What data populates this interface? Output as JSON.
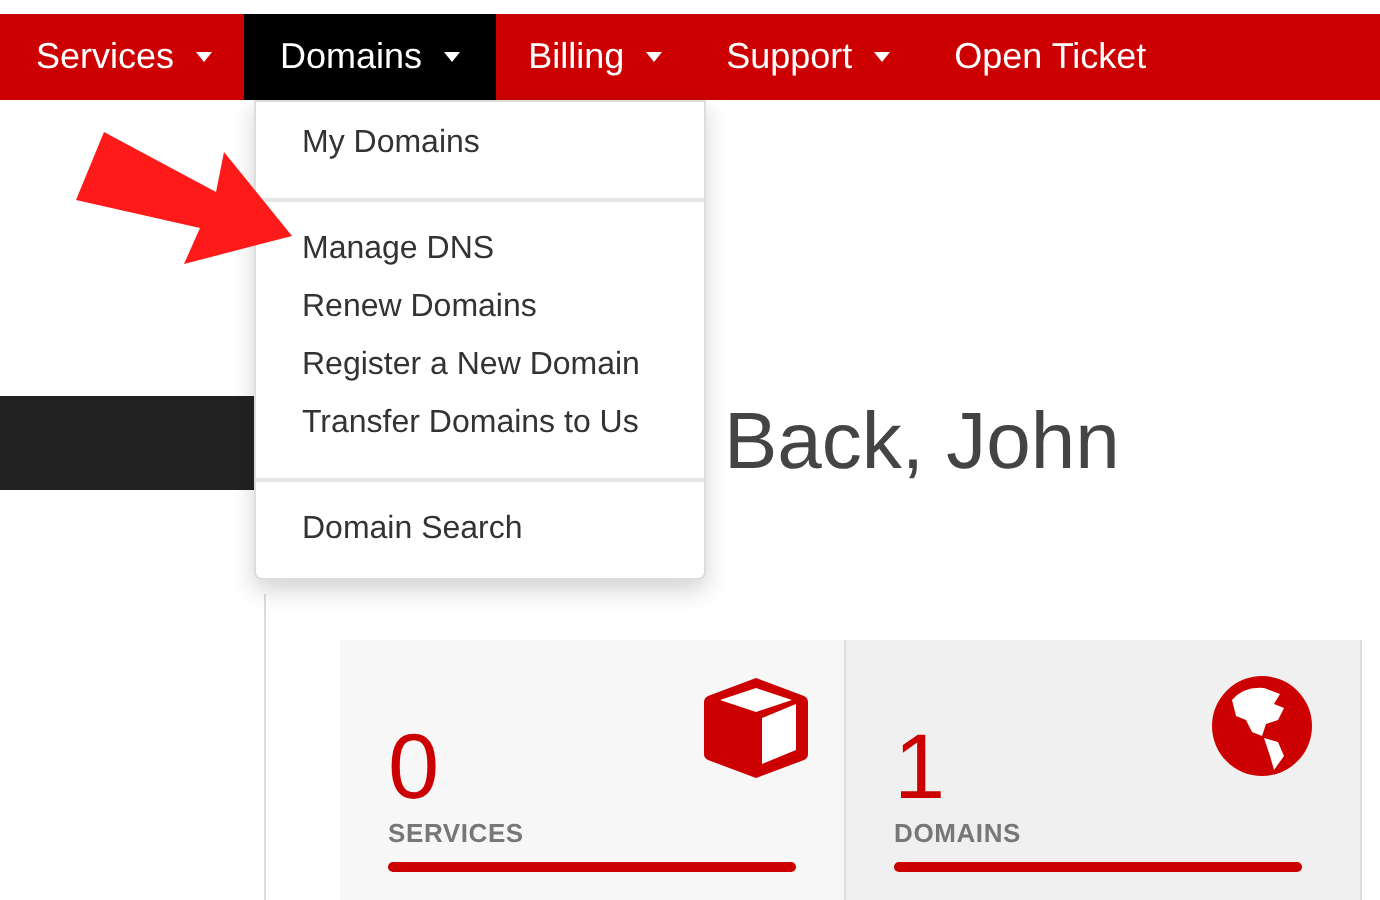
{
  "nav": [
    {
      "label": "Services",
      "caret": true,
      "selected": false
    },
    {
      "label": "Domains",
      "caret": true,
      "selected": true
    },
    {
      "label": "Billing",
      "caret": true,
      "selected": false
    },
    {
      "label": "Support",
      "caret": true,
      "selected": false
    },
    {
      "label": "Open Ticket",
      "caret": false,
      "selected": false
    }
  ],
  "dropdown": {
    "groups": [
      [
        "My Domains"
      ],
      [
        "Manage DNS",
        "Renew Domains",
        "Register a New Domain",
        "Transfer Domains to Us"
      ],
      [
        "Domain Search"
      ]
    ]
  },
  "heading": "Back, John",
  "stats": [
    {
      "kind": "box",
      "count": "0",
      "label": "SERVICES"
    },
    {
      "kind": "globe",
      "count": "1",
      "label": "DOMAINS"
    }
  ]
}
